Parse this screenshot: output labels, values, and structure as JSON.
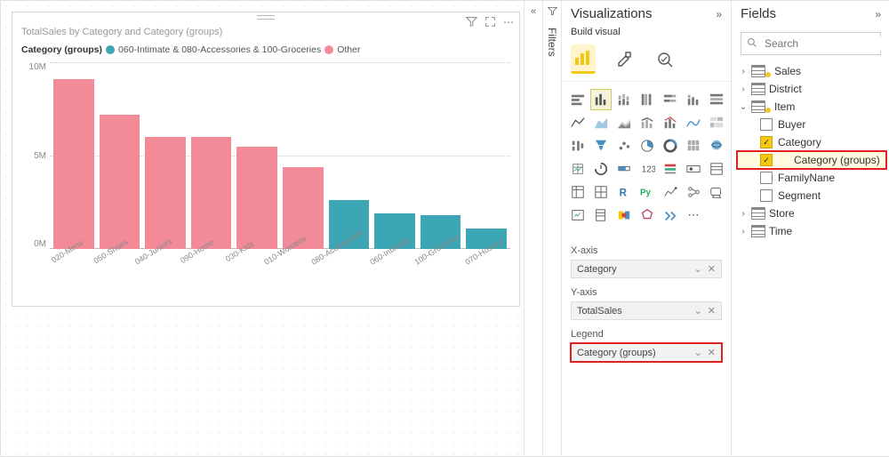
{
  "chart_data": {
    "type": "bar",
    "title": "TotalSales by Category and Category (groups)",
    "ylabel": "",
    "ylim": [
      0,
      10000000
    ],
    "yticks": [
      "10M",
      "5M",
      "0M"
    ],
    "categories": [
      "020-Mens",
      "050-Shoes",
      "040-Juniors",
      "090-Home",
      "030-Kids",
      "010-Womens",
      "080-Accessories",
      "060-Intimate",
      "100-Groceries",
      "070-Hosiery"
    ],
    "values_m": [
      9.1,
      7.2,
      6.0,
      6.0,
      5.5,
      4.4,
      2.6,
      1.9,
      1.8,
      1.1
    ],
    "group_index": [
      1,
      1,
      1,
      1,
      1,
      1,
      0,
      0,
      0,
      0
    ],
    "legend": [
      {
        "label": "060-Intimate & 080-Accessories & 100-Groceries",
        "color": "#3da6b5"
      },
      {
        "label": "Other",
        "color": "#f28a98"
      }
    ],
    "legend_title": "Category (groups)"
  },
  "tile_actions": {
    "filter": "▼",
    "focus": "⛶",
    "more": "⋯"
  },
  "filters_rail": {
    "label": "Filters",
    "chev": "«"
  },
  "vis": {
    "title": "Visualizations",
    "expand": "»",
    "build_label": "Build visual",
    "xaxis": {
      "label": "X-axis",
      "pill": "Category"
    },
    "yaxis": {
      "label": "Y-axis",
      "pill": "TotalSales"
    },
    "legend": {
      "label": "Legend",
      "pill": "Category (groups)"
    },
    "chev": "⌄",
    "close": "✕",
    "more": "⋯"
  },
  "fields": {
    "title": "Fields",
    "expand": "»",
    "search_placeholder": "Search",
    "tables": {
      "sales": "Sales",
      "district": "District",
      "item": "Item",
      "store": "Store",
      "time": "Time"
    },
    "item_cols": {
      "buyer": "Buyer",
      "category": "Category",
      "category_groups": "Category (groups)",
      "familyname": "FamilyNane",
      "segment": "Segment"
    }
  }
}
